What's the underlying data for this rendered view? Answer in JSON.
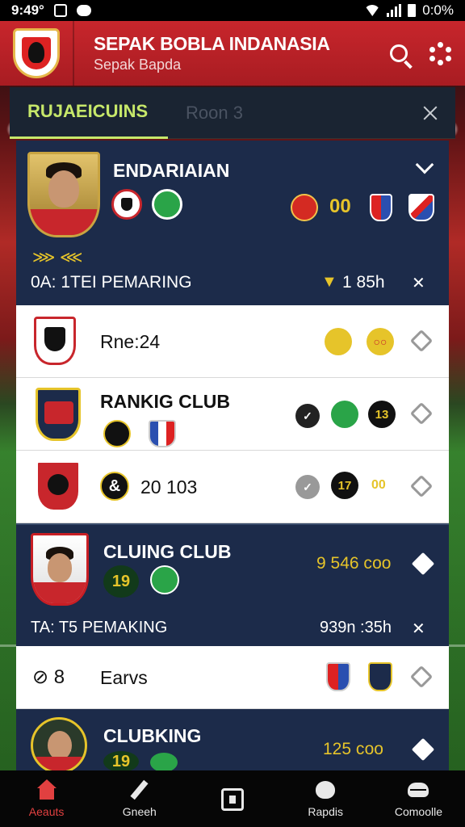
{
  "status_bar": {
    "time": "9:49°",
    "right_text": "0:0%"
  },
  "header": {
    "title": "SEPAK BOBLA INDANASIA",
    "subtitle": "Sepak Bapda"
  },
  "tabs": [
    {
      "label": "RUJAEICUINS",
      "active": true
    },
    {
      "label": "Roon 3",
      "active": false
    }
  ],
  "cards": {
    "card1": {
      "name": "ENDARIAIAN",
      "score": "00",
      "footer_label": "0A: 1TEI PEMARING",
      "stat": "1 85h"
    },
    "row1": {
      "text": "Rne:24"
    },
    "row2": {
      "name": "RANKIG CLUB",
      "badge": "13"
    },
    "row3": {
      "value": "20 103",
      "badge_a": "17",
      "badge_b": "00"
    },
    "card2": {
      "name": "CLUING CLUB",
      "badge": "19",
      "value": "9 546 соо",
      "footer_label": "TA: T5 PEMAKING",
      "stat": "939n :35h"
    },
    "row4": {
      "icon_text": "⊘ 8",
      "text": "Earvs"
    },
    "card3": {
      "name": "CLUBKING",
      "badge": "19",
      "value": "125 соо"
    }
  },
  "bottom_nav": [
    {
      "label": "Aeauts",
      "icon": "home-icon",
      "active": true
    },
    {
      "label": "Gneeh",
      "icon": "edit-icon",
      "active": false
    },
    {
      "label": "",
      "icon": "phone-icon",
      "active": false
    },
    {
      "label": "Rapdis",
      "icon": "cat-icon",
      "active": false
    },
    {
      "label": "Comoolle",
      "icon": "gamepad-icon",
      "active": false
    }
  ],
  "colors": {
    "header_red": "#c8262c",
    "card_navy": "#1c2b4a",
    "accent_green": "#c7e86a",
    "gold": "#e6c42a"
  }
}
